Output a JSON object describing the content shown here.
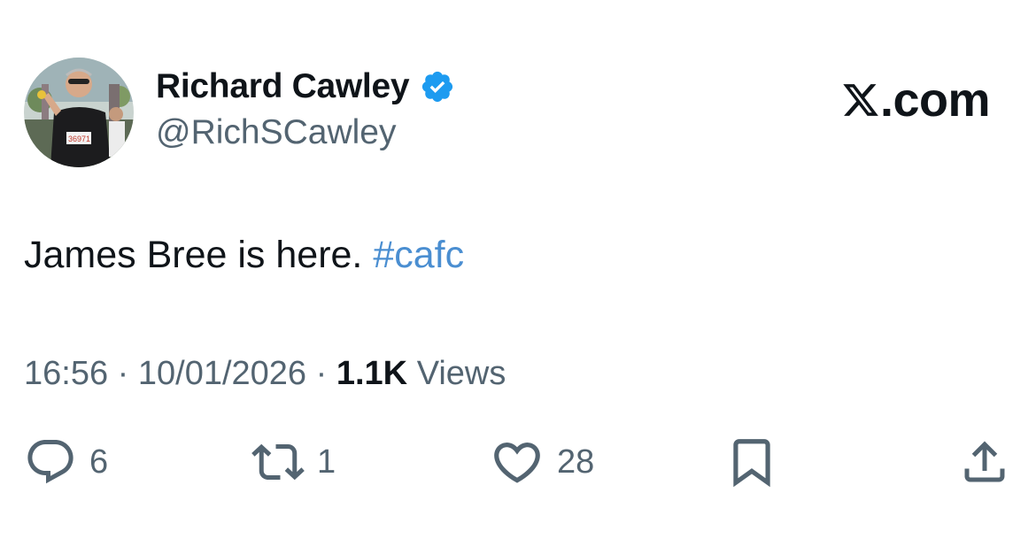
{
  "author": {
    "display_name": "Richard Cawley",
    "handle": "@RichSCawley",
    "verified": true,
    "avatar_bib": "36971"
  },
  "brand": {
    "label": ".com",
    "logo": "x-logo-icon"
  },
  "tweet": {
    "text": "James Bree is here. ",
    "hashtag": "#cafc"
  },
  "meta": {
    "time": "16:56",
    "separator": "·",
    "date": "10/01/2026",
    "views_count": "1.1K",
    "views_label": "Views"
  },
  "actions": {
    "replies": "6",
    "retweets": "1",
    "likes": "28"
  },
  "colors": {
    "text": "#0f1419",
    "secondary": "#536471",
    "link": "#4a8ed1",
    "verified": "#1d9bf0"
  }
}
